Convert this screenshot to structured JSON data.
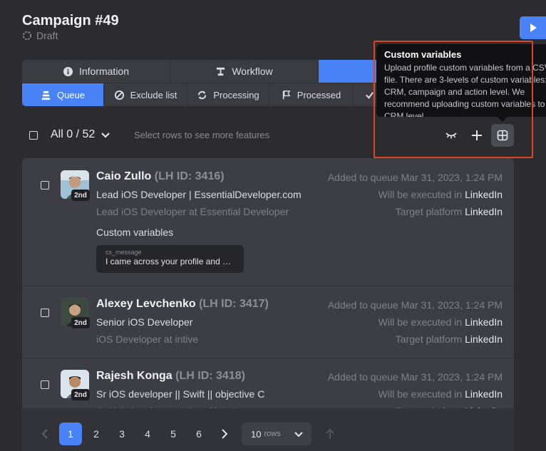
{
  "header": {
    "title": "Campaign #49",
    "status": "Draft"
  },
  "main_tabs": [
    {
      "label": "Information",
      "icon": "info-icon"
    },
    {
      "label": "Workflow",
      "icon": "workflow-icon"
    },
    {
      "label": "",
      "icon": ""
    }
  ],
  "sub_tabs": [
    {
      "label": "Queue",
      "icon": "queue-icon",
      "active": true
    },
    {
      "label": "Exclude list",
      "icon": "block-icon"
    },
    {
      "label": "Processing",
      "icon": "processing-icon"
    },
    {
      "label": "Processed",
      "icon": "flag-icon"
    },
    {
      "label": "",
      "icon": "check-icon"
    }
  ],
  "selection": {
    "count_label": "All 0 / 52",
    "hint": "Select rows to see more features"
  },
  "tooltip": {
    "title": "Custom variables",
    "body": "Upload profile custom variables from a CSV file. There are 3-levels of custom variables: CRM, campaign and action level. We recommend uploading custom variables to a CRM level."
  },
  "rows": [
    {
      "name": "Caio Zullo",
      "lh_id": "(LH ID: 3416)",
      "degree": "2nd",
      "headline": "Lead iOS Developer | EssentialDeveloper.com",
      "position": "Lead iOS Developer at Essential Developer",
      "added": "Added to queue Mar 31, 2023, 1:24 PM",
      "executed_prefix": "Will be executed in",
      "executed_value": "LinkedIn",
      "target_prefix": "Target platform",
      "target_value": "LinkedIn",
      "cv_heading": "Custom variables",
      "cv_key": "cs_message",
      "cv_value": "I came across your profile and …"
    },
    {
      "name": "Alexey Levchenko",
      "lh_id": "(LH ID: 3417)",
      "degree": "2nd",
      "headline": "Senior iOS Developer",
      "position": "iOS Developer at intive",
      "added": "Added to queue Mar 31, 2023, 1:24 PM",
      "executed_prefix": "Will be executed in",
      "executed_value": "LinkedIn",
      "target_prefix": "Target platform",
      "target_value": "LinkedIn"
    },
    {
      "name": "Rajesh Konga",
      "lh_id": "(LH ID: 3418)",
      "degree": "2nd",
      "headline": "Sr iOS developer || Swift || objective C",
      "position": "Sr iOS developer at Osn Global",
      "added": "Added to queue Mar 31, 2023, 1:24 PM",
      "executed_prefix": "Will be executed in",
      "executed_value": "LinkedIn",
      "target_prefix": "Target platform",
      "target_value": "LinkedIn"
    }
  ],
  "pagination": {
    "pages": [
      "1",
      "2",
      "3",
      "4",
      "5",
      "6"
    ],
    "active_page": "1",
    "rows_value": "10",
    "rows_unit": "rows"
  },
  "colors": {
    "accent": "#4a82f7",
    "highlight_border": "#d9461f"
  }
}
